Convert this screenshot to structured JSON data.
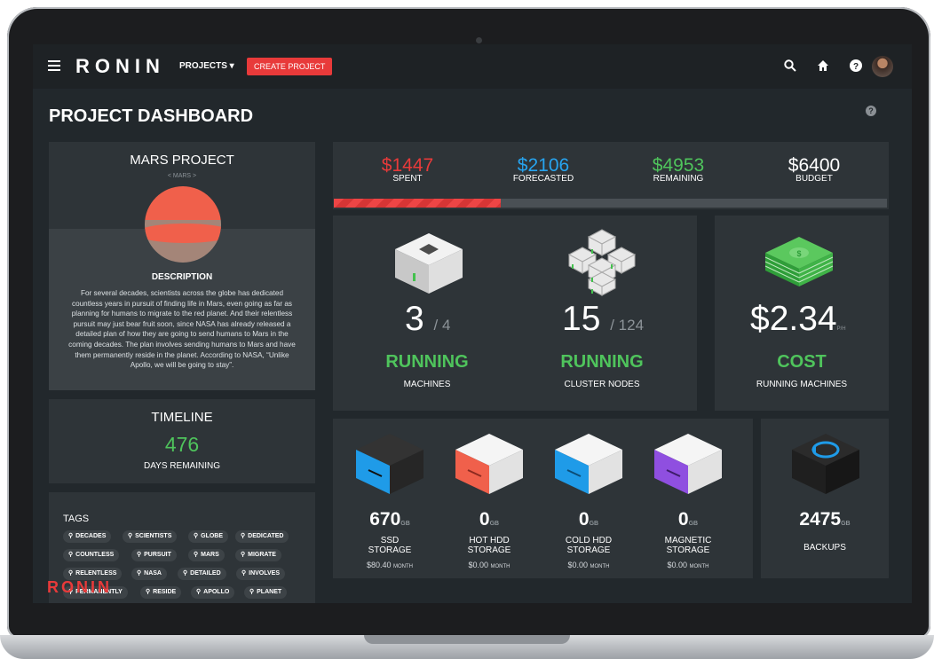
{
  "colors": {
    "accent": "#e83a3a",
    "spent": "#e83a3a",
    "forecasted": "#27a4ef",
    "remaining": "#4fc45c",
    "budget": "#ffffff",
    "running": "#4fc45c"
  },
  "topbar": {
    "brand": "RONIN",
    "projects_label": "PROJECTS ▾",
    "create_label": "CREATE PROJECT",
    "icons": [
      "menu-icon",
      "search-icon",
      "home-icon",
      "help-icon",
      "avatar"
    ]
  },
  "page": {
    "title": "PROJECT DASHBOARD"
  },
  "project": {
    "name": "MARS PROJECT",
    "code": "< MARS >",
    "description_heading": "DESCRIPTION",
    "description": "For several decades, scientists across the globe has dedicated countless years in pursuit of finding life in Mars, even going as far as planning for humans to migrate to the red planet. And their relentless pursuit may just bear fruit soon, since NASA has already released a detailed plan of how they are going to send humans to Mars in the coming decades. The plan involves sending humans to Mars and have them permanently reside in the planet. According to NASA, “Unlike Apollo, we will be going to stay”."
  },
  "timeline": {
    "heading": "TIMELINE",
    "days": "476",
    "label": "DAYS REMAINING"
  },
  "tags": {
    "heading": "TAGS",
    "items": [
      "DECADES",
      "SCIENTISTS",
      "GLOBE",
      "DEDICATED",
      "COUNTLESS",
      "PURSUIT",
      "MARS",
      "MIGRATE",
      "RELENTLESS",
      "NASA",
      "DETAILED",
      "INVOLVES",
      "PERMANENTLY",
      "RESIDE",
      "APOLLO",
      "PLANET"
    ]
  },
  "budget": {
    "spent": "$1447",
    "spent_label": "SPENT",
    "forecasted": "$2106",
    "forecasted_label": "FORECASTED",
    "remaining": "$4953",
    "remaining_label": "REMAINING",
    "budget": "$6400",
    "budget_label": "BUDGET",
    "spent_fraction": 0.301
  },
  "machines": {
    "running": "3",
    "total": "/ 4",
    "status": "RUNNING",
    "label": "MACHINES"
  },
  "cluster": {
    "running": "15",
    "total": "/ 124",
    "status": "RUNNING",
    "label": "CLUSTER NODES"
  },
  "cost": {
    "amount": "$2.34",
    "unit": "P/H",
    "status": "COST",
    "label": "RUNNING MACHINES"
  },
  "storage": [
    {
      "value": "670",
      "unit": "GB",
      "line1": "SSD",
      "line2": "STORAGE",
      "cost": "$80.40",
      "period": "MONTH"
    },
    {
      "value": "0",
      "unit": "GB",
      "line1": "HOT HDD",
      "line2": "STORAGE",
      "cost": "$0.00",
      "period": "MONTH"
    },
    {
      "value": "0",
      "unit": "GB",
      "line1": "COLD HDD",
      "line2": "STORAGE",
      "cost": "$0.00",
      "period": "MONTH"
    },
    {
      "value": "0",
      "unit": "GB",
      "line1": "MAGNETIC",
      "line2": "STORAGE",
      "cost": "$0.00",
      "period": "MONTH"
    }
  ],
  "backups": {
    "value": "2475",
    "unit": "GB",
    "label": "BACKUPS"
  },
  "watermark": "RONIN"
}
